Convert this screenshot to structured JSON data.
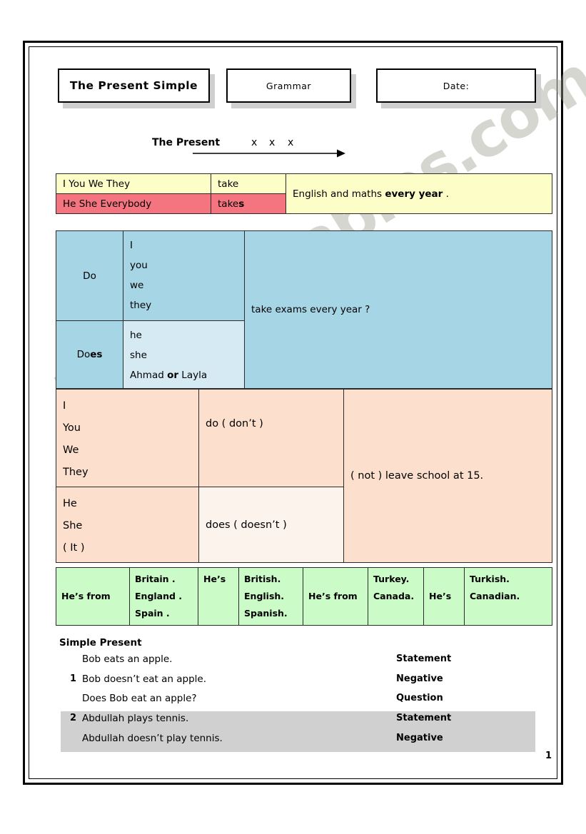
{
  "header": {
    "title": "The Present  Simple",
    "subject": "Grammar",
    "date_label": "Date:"
  },
  "timeline": {
    "label": "The Present",
    "marks": [
      "x",
      "x",
      "x"
    ]
  },
  "affirmative_table": {
    "rows": [
      {
        "subjects": "I    You    We   They",
        "verb": "take",
        "verb_suffix": ""
      },
      {
        "subjects": "He    She    Everybody",
        "verb": "take",
        "verb_suffix": "s"
      }
    ],
    "object_text": "English and maths ",
    "object_bold": "every year",
    "object_tail": " ."
  },
  "question_table": {
    "aux_plural": "Do",
    "aux_singular_stem": "Do",
    "aux_singular_suffix": "es",
    "subjects_plural": [
      "I",
      "you",
      "we",
      "they"
    ],
    "subjects_singular": [
      "he",
      "she"
    ],
    "subjects_singular_name_a": "Ahmad ",
    "subjects_singular_or": "or",
    "subjects_singular_name_b": " Layla",
    "predicate": "take exams every year ?"
  },
  "negative_table": {
    "subjects_plural": [
      "I",
      "You",
      "We",
      "They"
    ],
    "subjects_singular": [
      "He",
      "She",
      "( It )"
    ],
    "aux_plural": "do  ( don’t )",
    "aux_singular": "does  ( doesn’t )",
    "predicate": "( not )  leave school at 15."
  },
  "nationality_table": {
    "columns": [
      {
        "lines": [
          "He’s from"
        ],
        "align": "middle"
      },
      {
        "lines": [
          "Britain .",
          "England .",
          "Spain ."
        ],
        "align": "top"
      },
      {
        "lines": [
          "He’s"
        ],
        "align": "top"
      },
      {
        "lines": [
          "British.",
          "English.",
          "Spanish."
        ],
        "align": "top"
      },
      {
        "lines": [
          "He’s from"
        ],
        "align": "middle"
      },
      {
        "lines": [
          "Turkey.",
          "Canada."
        ],
        "align": "top"
      },
      {
        "lines": [
          "He’s"
        ],
        "align": "middle"
      },
      {
        "lines": [
          "Turkish.",
          "Canadian."
        ],
        "align": "top"
      }
    ]
  },
  "simple_present": {
    "title": "Simple Present",
    "rows": [
      {
        "num": "",
        "sentence": "Bob eats an apple.",
        "type": "Statement",
        "shaded": false
      },
      {
        "num": "1",
        "sentence": "Bob doesn’t eat an apple.",
        "type": "Negative",
        "shaded": false
      },
      {
        "num": "",
        "sentence": "Does Bob eat an apple?",
        "type": "Question",
        "shaded": false
      },
      {
        "num": "2",
        "sentence": "Abdullah plays tennis.",
        "type": "Statement",
        "shaded": true
      },
      {
        "num": "",
        "sentence": "Abdullah doesn’t play tennis.",
        "type": "Negative",
        "shaded": true
      }
    ]
  },
  "watermark": {
    "text": "ESLprintables.com"
  },
  "footer": {
    "page_number": "1"
  }
}
